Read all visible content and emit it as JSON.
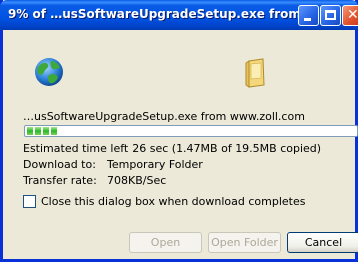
{
  "window": {
    "title": "9% of …usSoftwareUpgradeSetup.exe from …",
    "controls": {
      "close_glyph": "✕"
    }
  },
  "download": {
    "file_source": "…usSoftwareUpgradeSetup.exe from www.zoll.com",
    "progress_percent": 9,
    "estimated_time_label": "Estimated time left",
    "estimated_time_value": "26 sec (1.47MB of 19.5MB copied)",
    "download_to_label": "Download to:",
    "download_to_value": "Temporary Folder",
    "transfer_rate_label": "Transfer rate:",
    "transfer_rate_value": "708KB/Sec"
  },
  "options": {
    "close_when_complete_label": "Close this dialog box when download completes",
    "close_when_complete_checked": false
  },
  "buttons": {
    "open": "Open",
    "open_folder": "Open Folder",
    "cancel": "Cancel"
  },
  "icons": {
    "globe": "globe-icon",
    "folder": "folder-icon"
  },
  "colors": {
    "titlebar_blue": "#0053e3",
    "window_bg": "#ece9d8",
    "progress_green": "#2bb82b",
    "close_red": "#e2532e"
  }
}
